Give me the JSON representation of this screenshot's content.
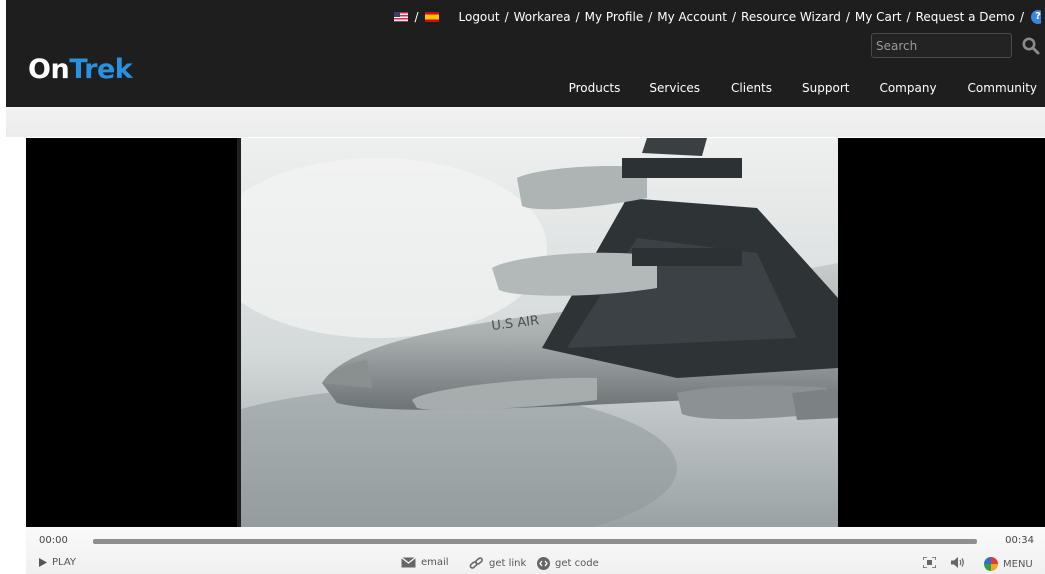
{
  "header": {
    "logo": {
      "part1": "On",
      "part2": "Trek"
    },
    "languages": [
      "english-flag-icon",
      "spanish-flag-icon"
    ],
    "top_links": [
      "Logout",
      "Workarea",
      "My Profile",
      "My Account",
      "Resource Wizard",
      "My Cart",
      "Request a Demo"
    ],
    "separator": "/",
    "search": {
      "placeholder": "Search"
    },
    "main_nav": [
      "Products",
      "Services",
      "Clients",
      "Support",
      "Company",
      "Community"
    ]
  },
  "player": {
    "current_time": "00:00",
    "duration": "00:34",
    "progress": 0,
    "play_label": "PLAY",
    "email_label": "email",
    "get_link_label": "get link",
    "get_code_label": "get code",
    "menu_label": "MENU"
  },
  "colors": {
    "header_bg": "#1e1e1e",
    "logo_accent": "#2a91e0",
    "progress_track": "#8f8f8f"
  }
}
